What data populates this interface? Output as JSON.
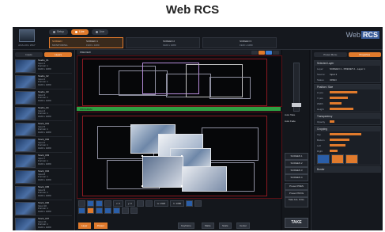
{
  "caption": "Web RCS",
  "brand": {
    "prefix": "Web",
    "highlight": "RCS"
  },
  "logo": {
    "text": "ANALOG WAY"
  },
  "top_tabs": [
    {
      "label": "Setup",
      "active": false
    },
    {
      "label": "Live",
      "active": true
    },
    {
      "label": "Live",
      "active": false
    }
  ],
  "sources": [
    {
      "l1": "SCREEN",
      "l2": "MONITORING",
      "r1": "SCREEN 1",
      "r2": "1920 x 1080",
      "active": true
    },
    {
      "l1": "",
      "l2": "",
      "r1": "SCREEN 2",
      "r2": "1920 x 1080",
      "active": false
    },
    {
      "l1": "",
      "l2": "",
      "r1": "SCREEN 3",
      "r2": "1920 x 1080",
      "active": false
    },
    {
      "l1": "",
      "l2": "",
      "r1": "SCREEN 4",
      "r2": "1920 x 1080",
      "active": false
    }
  ],
  "left_tabs": [
    "Inputs",
    "Layers"
  ],
  "clips": [
    {
      "name": "Studio_01",
      "l2": "Input 1",
      "l3": "Format: 1",
      "l4": "1920 x 1080"
    },
    {
      "name": "Studio_02",
      "l2": "Input 2",
      "l3": "Format: 1",
      "l4": "1920 x 1080"
    },
    {
      "name": "Studio_03",
      "l2": "Input 3",
      "l3": "Format: 1",
      "l4": "1920 x 1080"
    },
    {
      "name": "Studio_04",
      "l2": "Input 4",
      "l3": "Format: 1",
      "l4": "1920 x 1080"
    },
    {
      "name": "Stock_001",
      "l2": "Input 5",
      "l3": "Format: 1",
      "l4": "1920 x 1080"
    },
    {
      "name": "Stock_002",
      "l2": "Input 6",
      "l3": "Format: 1",
      "l4": "1920 x 1080"
    },
    {
      "name": "Stock_003",
      "l2": "Input 7",
      "l3": "Format: 1",
      "l4": "1920 x 1080"
    },
    {
      "name": "Stock_004",
      "l2": "Input 8",
      "l3": "Format: 1",
      "l4": "1920 x 1080"
    },
    {
      "name": "Stock_005",
      "l2": "Input 9",
      "l3": "Format: 1",
      "l4": "1920 x 1080"
    },
    {
      "name": "Stock_006",
      "l2": "Input 10",
      "l3": "Format: 1",
      "l4": "1920 x 1080"
    },
    {
      "name": "Stock_007",
      "l2": "Input 11",
      "l3": "Format: 1",
      "l4": "1920 x 1080"
    }
  ],
  "center": {
    "preview_label": "PREVIEW",
    "program_label": "PROGRAM",
    "fields": [
      "x: 0",
      "y: 0",
      "w: 1920",
      "h: 1080"
    ],
    "bottom_buttons": [
      "Layer",
      "Preset",
      "Keyframe",
      "Matte",
      "Scale",
      "Center"
    ]
  },
  "mid": {
    "labels": [
      "Auto Take",
      "Auto Fade"
    ],
    "buttons": [
      "SCREEN 1",
      "SCREEN 2",
      "SCREEN 3",
      "SCREEN 4",
      "Preset PRES",
      "Preset PROG",
      "Take ALL FULL",
      "TAKE ALL"
    ],
    "take": "TAKE"
  },
  "right": {
    "tabs": [
      "Preset Menu",
      "Properties"
    ],
    "sections": [
      {
        "title": "Selected Layer",
        "rows": [
          {
            "k": "Layer:",
            "v": "SCREEN 1 - PRESET A - Layer 1"
          },
          {
            "k": "Source:",
            "v": "Input 1"
          },
          {
            "k": "Status:",
            "v": "OPEN"
          }
        ]
      },
      {
        "title": "Position / Size",
        "rows": [
          {
            "k": "H pos",
            "bar": 0.7
          },
          {
            "k": "V pos",
            "bar": 0.45
          },
          {
            "k": "Width",
            "bar": 0.3
          },
          {
            "k": "Height",
            "bar": 0.6
          }
        ]
      },
      {
        "title": "Transparency",
        "rows": [
          {
            "k": "Opacity",
            "bar": 0.12
          }
        ]
      },
      {
        "title": "Cropping",
        "rows": [
          {
            "k": "Top",
            "bar": 0.8
          },
          {
            "k": "Bottom",
            "bar": 0.5
          },
          {
            "k": "Left",
            "bar": 0.4
          },
          {
            "k": "Right",
            "bar": 0.2
          }
        ]
      },
      {
        "title": "Border",
        "rows": []
      }
    ]
  },
  "colors": {
    "accent": "#e07a2c",
    "program_green": "#2ea043",
    "brand_blue": "#3b5d9a"
  }
}
